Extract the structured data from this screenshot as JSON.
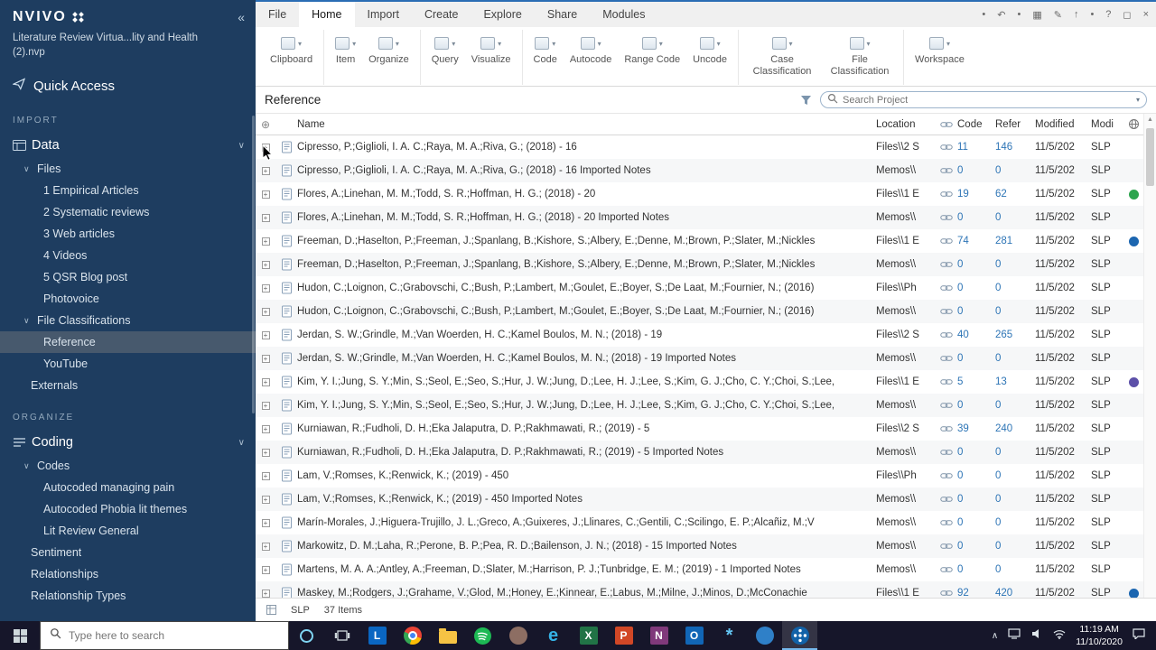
{
  "sidebar": {
    "logo": "NVIVO",
    "collapse_glyph": "«",
    "project_name": "Literature Review Virtua...lity and Health (2).nvp",
    "quick_access": "Quick Access",
    "sections": [
      {
        "label": "IMPORT",
        "items": [
          {
            "label": "Data",
            "level": 0,
            "root": true,
            "icon": "data",
            "chevron": "∨"
          },
          {
            "label": "Files",
            "level": 1,
            "expander": "∨"
          },
          {
            "label": "1 Empirical Articles",
            "level": 2
          },
          {
            "label": "2 Systematic reviews",
            "level": 2
          },
          {
            "label": "3 Web articles",
            "level": 2
          },
          {
            "label": "4 Videos",
            "level": 2
          },
          {
            "label": "5 QSR Blog post",
            "level": 2
          },
          {
            "label": "Photovoice",
            "level": 2
          },
          {
            "label": "File Classifications",
            "level": 1,
            "expander": "∨"
          },
          {
            "label": "Reference",
            "level": 2,
            "selected": true
          },
          {
            "label": "YouTube",
            "level": 2
          },
          {
            "label": "Externals",
            "level": 1
          }
        ]
      },
      {
        "label": "ORGANIZE",
        "items": [
          {
            "label": "Coding",
            "level": 0,
            "root": true,
            "icon": "coding",
            "chevron": "∨"
          },
          {
            "label": "Codes",
            "level": 1,
            "expander": "∨"
          },
          {
            "label": "Autocoded managing pain",
            "level": 2
          },
          {
            "label": "Autocoded Phobia lit themes",
            "level": 2
          },
          {
            "label": "Lit Review General",
            "level": 2
          },
          {
            "label": "Sentiment",
            "level": 1
          },
          {
            "label": "Relationships",
            "level": 1
          },
          {
            "label": "Relationship Types",
            "level": 1
          }
        ]
      }
    ]
  },
  "menu": {
    "tabs": [
      {
        "label": "File"
      },
      {
        "label": "Home",
        "active": true
      },
      {
        "label": "Import"
      },
      {
        "label": "Create"
      },
      {
        "label": "Explore"
      },
      {
        "label": "Share"
      },
      {
        "label": "Modules"
      }
    ]
  },
  "titlebar": {
    "icons": [
      {
        "name": "pin-icon",
        "glyph": "•"
      },
      {
        "name": "undo-icon",
        "glyph": "↶"
      },
      {
        "name": "redo-icon",
        "glyph": "•"
      },
      {
        "name": "grid-view-icon",
        "glyph": "▦"
      },
      {
        "name": "edit-icon",
        "glyph": "✎"
      },
      {
        "name": "up-arrow-icon",
        "glyph": "↑"
      },
      {
        "name": "sync-icon",
        "glyph": "•"
      },
      {
        "name": "help-icon",
        "glyph": "?"
      },
      {
        "name": "feedback-icon",
        "glyph": "◻"
      },
      {
        "name": "close-icon",
        "glyph": "×"
      }
    ]
  },
  "ribbon": {
    "groups": [
      {
        "buttons": [
          {
            "label": "Clipboard"
          }
        ]
      },
      {
        "buttons": [
          {
            "label": "Item"
          },
          {
            "label": "Organize"
          }
        ]
      },
      {
        "buttons": [
          {
            "label": "Query"
          },
          {
            "label": "Visualize"
          }
        ]
      },
      {
        "buttons": [
          {
            "label": "Code"
          },
          {
            "label": "Autocode"
          },
          {
            "label": "Range Code"
          },
          {
            "label": "Uncode"
          }
        ]
      },
      {
        "buttons": [
          {
            "label": "Case Classification"
          },
          {
            "label": "File Classification"
          }
        ]
      },
      {
        "buttons": [
          {
            "label": "Workspace"
          }
        ]
      }
    ]
  },
  "view": {
    "title": "Reference",
    "search_placeholder": "Search Project"
  },
  "table": {
    "columns": {
      "name": "Name",
      "location": "Location",
      "code": "Code",
      "refer": "Refer",
      "modified": "Modified",
      "modified_by": "Modi"
    },
    "rows": [
      {
        "name": "Cipresso, P.;Giglioli, I. A. C.;Raya, M. A.;Riva, G.; (2018) - 16",
        "location": "Files\\\\2 S",
        "code": 11,
        "refer": 146,
        "modified": "11/5/202",
        "modified_by": "SLP"
      },
      {
        "name": "Cipresso, P.;Giglioli, I. A. C.;Raya, M. A.;Riva, G.; (2018) - 16 Imported Notes",
        "location": "Memos\\\\",
        "code": 0,
        "refer": 0,
        "modified": "11/5/202",
        "modified_by": "SLP"
      },
      {
        "name": "Flores, A.;Linehan, M. M.;Todd, S. R.;Hoffman, H. G.; (2018) - 20",
        "location": "Files\\\\1 E",
        "code": 19,
        "refer": 62,
        "modified": "11/5/202",
        "modified_by": "SLP",
        "dot": "#2da44e"
      },
      {
        "name": "Flores, A.;Linehan, M. M.;Todd, S. R.;Hoffman, H. G.; (2018) - 20 Imported Notes",
        "location": "Memos\\\\",
        "code": 0,
        "refer": 0,
        "modified": "11/5/202",
        "modified_by": "SLP"
      },
      {
        "name": "Freeman, D.;Haselton, P.;Freeman, J.;Spanlang, B.;Kishore, S.;Albery, E.;Denne, M.;Brown, P.;Slater, M.;Nickles",
        "location": "Files\\\\1 E",
        "code": 74,
        "refer": 281,
        "modified": "11/5/202",
        "modified_by": "SLP",
        "dot": "#1c66b0"
      },
      {
        "name": "Freeman, D.;Haselton, P.;Freeman, J.;Spanlang, B.;Kishore, S.;Albery, E.;Denne, M.;Brown, P.;Slater, M.;Nickles",
        "location": "Memos\\\\",
        "code": 0,
        "refer": 0,
        "modified": "11/5/202",
        "modified_by": "SLP"
      },
      {
        "name": "Hudon, C.;Loignon, C.;Grabovschi, C.;Bush, P.;Lambert, M.;Goulet, É.;Boyer, S.;De Laat, M.;Fournier, N.; (2016)",
        "location": "Files\\\\Ph",
        "code": 0,
        "refer": 0,
        "modified": "11/5/202",
        "modified_by": "SLP"
      },
      {
        "name": "Hudon, C.;Loignon, C.;Grabovschi, C.;Bush, P.;Lambert, M.;Goulet, É.;Boyer, S.;De Laat, M.;Fournier, N.; (2016)",
        "location": "Memos\\\\",
        "code": 0,
        "refer": 0,
        "modified": "11/5/202",
        "modified_by": "SLP"
      },
      {
        "name": "Jerdan, S. W.;Grindle, M.;Van Woerden, H. C.;Kamel Boulos, M. N.; (2018) - 19",
        "location": "Files\\\\2 S",
        "code": 40,
        "refer": 265,
        "modified": "11/5/202",
        "modified_by": "SLP"
      },
      {
        "name": "Jerdan, S. W.;Grindle, M.;Van Woerden, H. C.;Kamel Boulos, M. N.; (2018) - 19 Imported Notes",
        "location": "Memos\\\\",
        "code": 0,
        "refer": 0,
        "modified": "11/5/202",
        "modified_by": "SLP"
      },
      {
        "name": "Kim, Y. I.;Jung, S. Y.;Min, S.;Seol, E.;Seo, S.;Hur, J. W.;Jung, D.;Lee, H. J.;Lee, S.;Kim, G. J.;Cho, C. Y.;Choi, S.;Lee,",
        "location": "Files\\\\1 E",
        "code": 5,
        "refer": 13,
        "modified": "11/5/202",
        "modified_by": "SLP",
        "dot": "#5c50a8"
      },
      {
        "name": "Kim, Y. I.;Jung, S. Y.;Min, S.;Seol, E.;Seo, S.;Hur, J. W.;Jung, D.;Lee, H. J.;Lee, S.;Kim, G. J.;Cho, C. Y.;Choi, S.;Lee,",
        "location": "Memos\\\\",
        "code": 0,
        "refer": 0,
        "modified": "11/5/202",
        "modified_by": "SLP"
      },
      {
        "name": "Kurniawan, R.;Fudholi, D. H.;Eka Jalaputra, D. P.;Rakhmawati, R.; (2019) - 5",
        "location": "Files\\\\2 S",
        "code": 39,
        "refer": 240,
        "modified": "11/5/202",
        "modified_by": "SLP"
      },
      {
        "name": "Kurniawan, R.;Fudholi, D. H.;Eka Jalaputra, D. P.;Rakhmawati, R.; (2019) - 5 Imported Notes",
        "location": "Memos\\\\",
        "code": 0,
        "refer": 0,
        "modified": "11/5/202",
        "modified_by": "SLP"
      },
      {
        "name": "Lam, V.;Romses, K.;Renwick, K.; (2019) - 450",
        "location": "Files\\\\Ph",
        "code": 0,
        "refer": 0,
        "modified": "11/5/202",
        "modified_by": "SLP"
      },
      {
        "name": "Lam, V.;Romses, K.;Renwick, K.; (2019) - 450 Imported Notes",
        "location": "Memos\\\\",
        "code": 0,
        "refer": 0,
        "modified": "11/5/202",
        "modified_by": "SLP"
      },
      {
        "name": "Marín-Morales, J.;Higuera-Trujillo, J. L.;Greco, A.;Guixeres, J.;Llinares, C.;Gentili, C.;Scilingo, E. P.;Alcañiz, M.;V",
        "location": "Memos\\\\",
        "code": 0,
        "refer": 0,
        "modified": "11/5/202",
        "modified_by": "SLP"
      },
      {
        "name": "Markowitz, D. M.;Laha, R.;Perone, B. P.;Pea, R. D.;Bailenson, J. N.; (2018) - 15 Imported Notes",
        "location": "Memos\\\\",
        "code": 0,
        "refer": 0,
        "modified": "11/5/202",
        "modified_by": "SLP"
      },
      {
        "name": "Martens, M. A. A.;Antley, A.;Freeman, D.;Slater, M.;Harrison, P. J.;Tunbridge, E. M.; (2019) - 1 Imported Notes",
        "location": "Memos\\\\",
        "code": 0,
        "refer": 0,
        "modified": "11/5/202",
        "modified_by": "SLP"
      },
      {
        "name": "Maskey, M.;Rodgers, J.;Grahame, V.;Glod, M.;Honey, E.;Kinnear, E.;Labus, M.;Milne, J.;Minos, D.;McConachie",
        "location": "Files\\\\1 E",
        "code": 92,
        "refer": 420,
        "modified": "11/5/202",
        "modified_by": "SLP",
        "dot": "#1c66b0"
      }
    ]
  },
  "status": {
    "initials": "SLP",
    "items_count": "37 Items"
  },
  "taskbar": {
    "search_placeholder": "Type here to search",
    "time": "11:19 AM",
    "date": "11/10/2020",
    "apps": [
      {
        "name": "cortana-icon",
        "kind": "ring",
        "color": "#7fd4f2"
      },
      {
        "name": "task-view-icon",
        "kind": "taskview"
      },
      {
        "name": "linkedin-icon",
        "kind": "square",
        "color": "#0a66c2",
        "letter": "L"
      },
      {
        "name": "chrome-icon",
        "kind": "chrome"
      },
      {
        "name": "file-explorer-icon",
        "kind": "folder"
      },
      {
        "name": "spotify-icon",
        "kind": "spotify",
        "color": "#1db954"
      },
      {
        "name": "app-icon-1",
        "kind": "circle",
        "color": "#8d6e63"
      },
      {
        "name": "edge-icon",
        "kind": "letter",
        "color": "#35b2e6",
        "letter": "e"
      },
      {
        "name": "excel-icon",
        "kind": "square",
        "color": "#217346",
        "letter": "X"
      },
      {
        "name": "powerpoint-icon",
        "kind": "square",
        "color": "#d24726",
        "letter": "P"
      },
      {
        "name": "onenote-icon",
        "kind": "square",
        "color": "#80397b",
        "letter": "N"
      },
      {
        "name": "outlook-icon",
        "kind": "square",
        "color": "#1166b6",
        "letter": "O"
      },
      {
        "name": "app-icon-2",
        "kind": "letter",
        "color": "#63c5f2",
        "letter": "*"
      },
      {
        "name": "app-icon-3",
        "kind": "circle",
        "color": "#2f80c8"
      },
      {
        "name": "nvivo-taskbar-icon",
        "kind": "nvivo",
        "color": "#1262a8",
        "active": true
      }
    ]
  }
}
